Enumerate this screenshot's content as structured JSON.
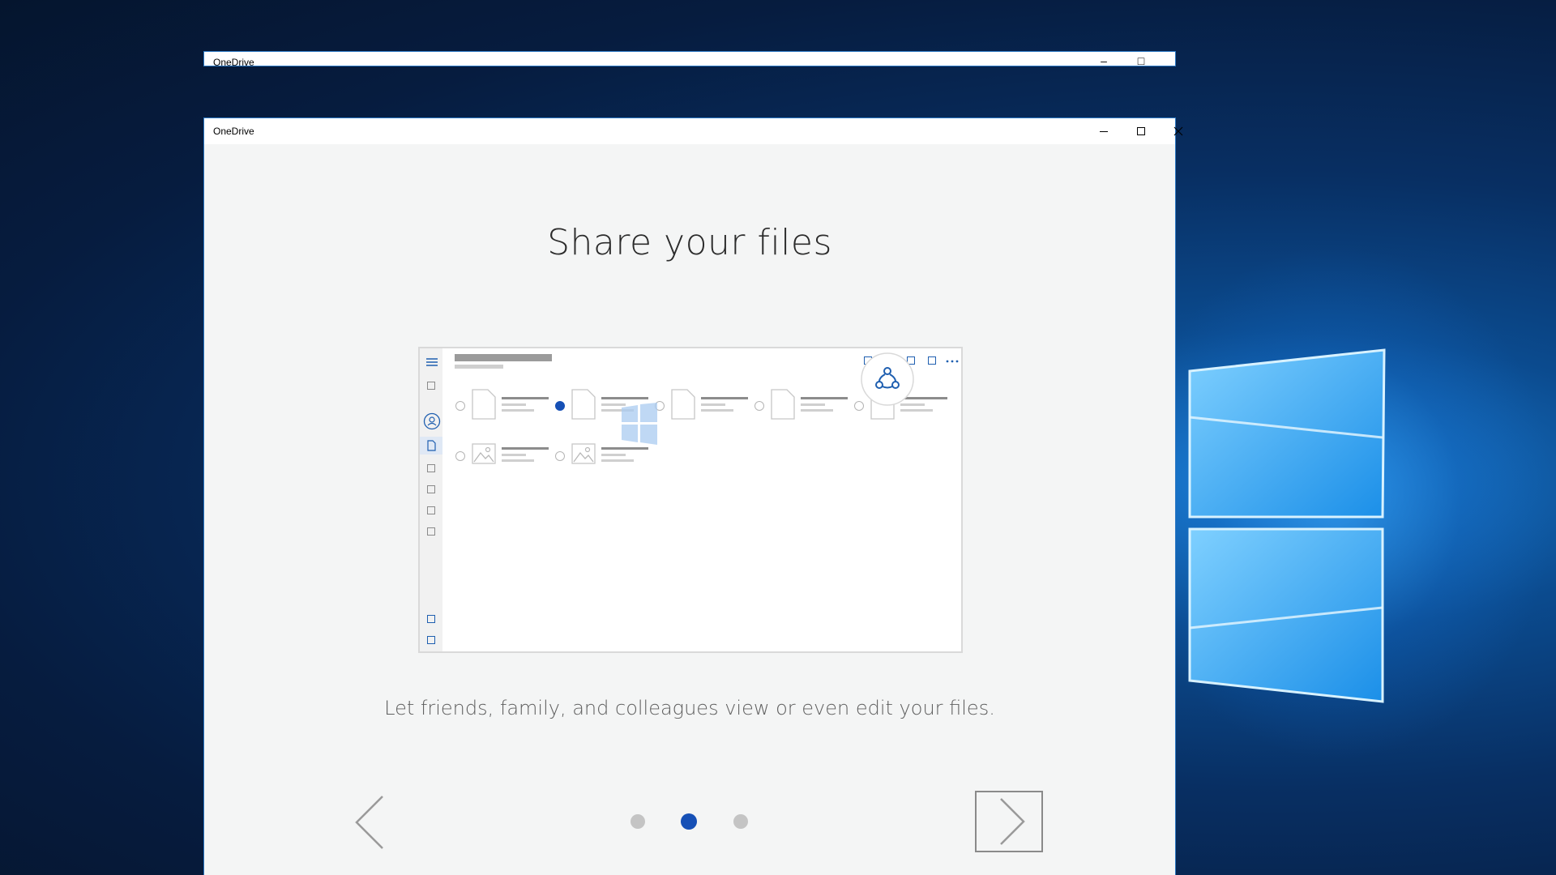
{
  "background_window": {
    "title": "OneDrive"
  },
  "window": {
    "title": "OneDrive",
    "controls": {
      "minimize": "minimize-icon",
      "maximize": "maximize-icon",
      "close": "close-icon"
    }
  },
  "onboarding": {
    "heading": "Share your files",
    "description": "Let friends, family, and colleagues view or even edit your files.",
    "page_count": 3,
    "active_page": 2,
    "icons": {
      "previous": "chevron-left-icon",
      "next": "chevron-right-icon",
      "share": "share-icon"
    }
  },
  "colors": {
    "accent": "#1650b6",
    "window_border": "#2b78c4",
    "content_bg": "#f4f5f5",
    "inactive_dot": "#c4c4c4"
  }
}
